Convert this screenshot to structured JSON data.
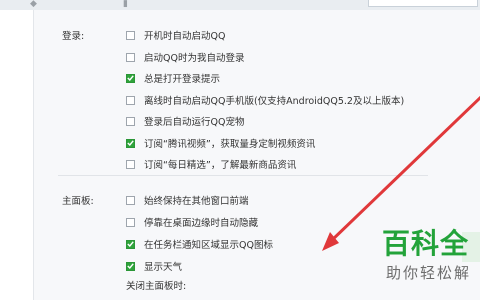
{
  "sections": {
    "login": {
      "label": "登录:",
      "options": [
        {
          "label": "开机时自动启动QQ",
          "checked": false
        },
        {
          "label": "启动QQ时为我自动登录",
          "checked": false
        },
        {
          "label": "总是打开登录提示",
          "checked": true
        },
        {
          "label": "离线时自动启动QQ手机版(仅支持AndroidQQ5.2及以上版本)",
          "checked": false
        },
        {
          "label": "登录后自动运行QQ宠物",
          "checked": false
        },
        {
          "label": "订阅“腾讯视频”，获取量身定制视频资讯",
          "checked": true
        },
        {
          "label": "订阅“每日精选”，了解最新商品资讯",
          "checked": false
        }
      ]
    },
    "main_panel": {
      "label": "主面板:",
      "options": [
        {
          "label": "始终保持在其他窗口前端",
          "checked": false
        },
        {
          "label": "停靠在桌面边缘时自动隐藏",
          "checked": false
        },
        {
          "label": "在任务栏通知区域显示QQ图标",
          "checked": true
        },
        {
          "label": "显示天气",
          "checked": true
        }
      ],
      "close_label": "关闭主面板时:"
    }
  },
  "watermark": {
    "title": "百科全",
    "subtitle": "助你轻松解",
    "color": "#23a33a"
  },
  "colors": {
    "checkbox_checked": "#2fa33b",
    "arrow": "#e0383a",
    "content_bg": "#f7f8fa"
  }
}
